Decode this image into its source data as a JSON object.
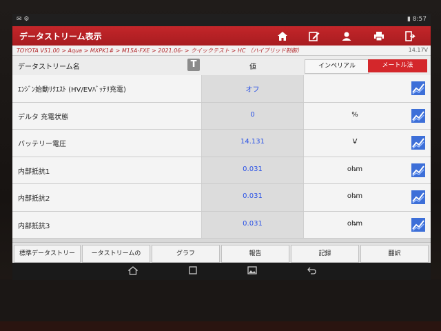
{
  "status_bar": {
    "time": "8:57"
  },
  "header": {
    "title": "データストリーム表示",
    "icons": [
      "home-icon",
      "edit-icon",
      "user-icon",
      "print-icon",
      "exit-icon"
    ]
  },
  "breadcrumb": "TOYOTA V51.00 > Aqua > MXPK1# > M15A-FXE > 2021.06- > クイックテスト > HC （ハイブリッド制御）",
  "voltage": "14.17V",
  "table_header": {
    "name": "データストリーム名",
    "value": "値",
    "imperial": "インペリアル",
    "metric": "メートル法"
  },
  "rows": [
    {
      "name": "ｴﾝｼﾞﾝ始動ﾘｸｴｽﾄ (HV/EVﾊﾞｯﾃﾘ充電)",
      "value": "オフ",
      "unit": "",
      "dropdown": false
    },
    {
      "name": "デルタ 充電状態",
      "value": "0",
      "unit": "%",
      "dropdown": false
    },
    {
      "name": "バッテリー電圧",
      "value": "14.131",
      "unit": "V",
      "dropdown": true
    },
    {
      "name": "内部抵抗1",
      "value": "0.031",
      "unit": "ohm",
      "dropdown": true
    },
    {
      "name": "内部抵抗2",
      "value": "0.031",
      "unit": "ohm",
      "dropdown": true
    },
    {
      "name": "内部抵抗3",
      "value": "0.031",
      "unit": "ohm",
      "dropdown": true
    }
  ],
  "bottom_buttons": {
    "standard": "標準データストリー",
    "datastream": "ータストリームの",
    "graph": "グラフ",
    "report": "報告",
    "record": "記録",
    "translate": "翻訳"
  },
  "colors": {
    "accent": "#c4262a",
    "value_text": "#2a52e6"
  }
}
